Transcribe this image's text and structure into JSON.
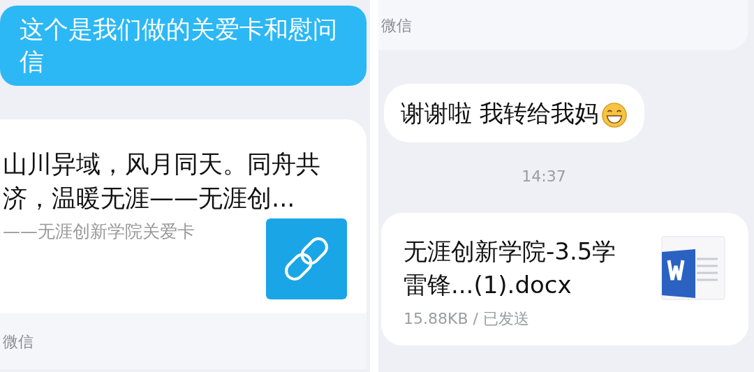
{
  "panels": [
    {
      "messages": [
        {
          "kind": "sent_bubble",
          "text": "这个是我们做的关爱卡和慰问信"
        },
        {
          "kind": "link_card",
          "title": "山川异域，风月同天。同舟共济，温暖无涯——无涯创...",
          "description": "——无涯创新学院关爱卡",
          "source": "微信"
        }
      ]
    },
    {
      "messages": [
        {
          "kind": "source_footer",
          "source": "微信"
        },
        {
          "kind": "received_bubble",
          "text": "谢谢啦 我转给我妈",
          "emoji": true
        },
        {
          "kind": "time",
          "text": "14:37"
        },
        {
          "kind": "file_card",
          "name": "无涯创新学院-3.5学雷锋...(1).docx",
          "size": "15.88KB / 已发送"
        }
      ]
    }
  ]
}
